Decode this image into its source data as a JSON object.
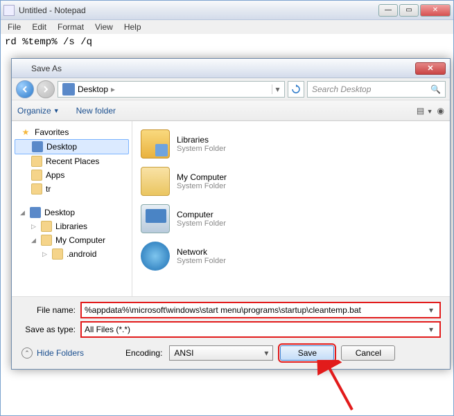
{
  "notepad": {
    "title": "Untitled - Notepad",
    "menu": {
      "file": "File",
      "edit": "Edit",
      "format": "Format",
      "view": "View",
      "help": "Help"
    },
    "content": "rd %temp% /s /q"
  },
  "dialog": {
    "title": "Save As",
    "breadcrumb": {
      "location": "Desktop"
    },
    "search_placeholder": "Search Desktop",
    "toolbar": {
      "organize": "Organize",
      "newfolder": "New folder"
    },
    "tree": {
      "favorites": "Favorites",
      "fav_items": [
        "Desktop",
        "Recent Places",
        "Apps",
        "tr"
      ],
      "desktop": "Desktop",
      "libraries": "Libraries",
      "mycomputer": "My Computer",
      "android": ".android"
    },
    "listing": [
      {
        "name": "Libraries",
        "sub": "System Folder",
        "kind": "lib"
      },
      {
        "name": "My Computer",
        "sub": "System Folder",
        "kind": "fold"
      },
      {
        "name": "Computer",
        "sub": "System Folder",
        "kind": "comp"
      },
      {
        "name": "Network",
        "sub": "System Folder",
        "kind": "net"
      }
    ],
    "labels": {
      "filename": "File name:",
      "savetype": "Save as type:",
      "encoding": "Encoding:",
      "hide_folders": "Hide Folders",
      "save": "Save",
      "cancel": "Cancel"
    },
    "values": {
      "filename": "%appdata%\\microsoft\\windows\\start menu\\programs\\startup\\cleantemp.bat",
      "savetype": "All Files (*.*)",
      "encoding": "ANSI"
    }
  },
  "annotation": {
    "highlight_color": "#e21b1b"
  }
}
